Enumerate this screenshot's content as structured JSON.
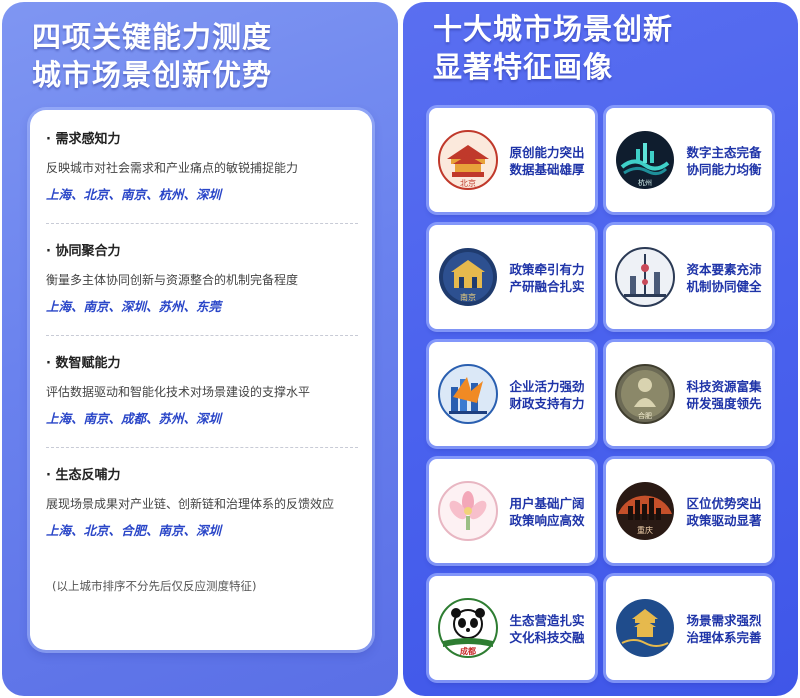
{
  "left": {
    "title_line1": "四项关键能力测度",
    "title_line2": "城市场景创新优势",
    "sections": [
      {
        "title": "需求感知力",
        "desc": "反映城市对社会需求和产业痛点的敏锐捕捉能力",
        "cities": "上海、北京、南京、杭州、深圳"
      },
      {
        "title": "协同聚合力",
        "desc": "衡量多主体协同创新与资源整合的机制完备程度",
        "cities": "上海、南京、深圳、苏州、东莞"
      },
      {
        "title": "数智赋能力",
        "desc": "评估数据驱动和智能化技术对场景建设的支撑水平",
        "cities": "上海、南京、成都、苏州、深圳"
      },
      {
        "title": "生态反哺力",
        "desc": "展现场景成果对产业链、创新链和治理体系的反馈效应",
        "cities": "上海、北京、合肥、南京、深圳"
      }
    ],
    "bullet": "·",
    "note": "(以上城市排序不分先后仅反应测度特征)"
  },
  "right": {
    "title_line1": "十大城市场景创新",
    "title_line2": "显著特征画像",
    "tiles": [
      {
        "city_badge": "北京",
        "line1": "原创能力突出",
        "line2": "数据基础雄厚",
        "icon": "beijing-emblem-icon"
      },
      {
        "city_badge": "杭州",
        "line1": "数字主态完备",
        "line2": "协同能力均衡",
        "icon": "hangzhou-emblem-icon"
      },
      {
        "city_badge": "南京",
        "line1": "政策牵引有力",
        "line2": "产研融合扎实",
        "icon": "nanjing-emblem-icon"
      },
      {
        "city_badge": "",
        "line1": "资本要素充沛",
        "line2": "机制协同健全",
        "icon": "shanghai-emblem-icon"
      },
      {
        "city_badge": "",
        "line1": "企业活力强劲",
        "line2": "财政支持有力",
        "icon": "shenzhen-emblem-icon"
      },
      {
        "city_badge": "合肥",
        "line1": "科技资源富集",
        "line2": "研发强度领先",
        "icon": "hefei-emblem-icon"
      },
      {
        "city_badge": "",
        "line1": "用户基础广阔",
        "line2": "政策响应高效",
        "icon": "guangzhou-emblem-icon"
      },
      {
        "city_badge": "重庆",
        "line1": "区位优势突出",
        "line2": "政策驱动显著",
        "icon": "chongqing-emblem-icon"
      },
      {
        "city_badge": "成都",
        "line1": "生态营造扎实",
        "line2": "文化科技交融",
        "icon": "chengdu-emblem-icon"
      },
      {
        "city_badge": "",
        "line1": "场景需求强烈",
        "line2": "治理体系完善",
        "icon": "wuhan-emblem-icon"
      }
    ]
  },
  "colors": {
    "left_bg": "#6a82ee",
    "right_bg": "#4a62ee",
    "city_text": "#2a46c8",
    "tile_text": "#1f34a8"
  }
}
